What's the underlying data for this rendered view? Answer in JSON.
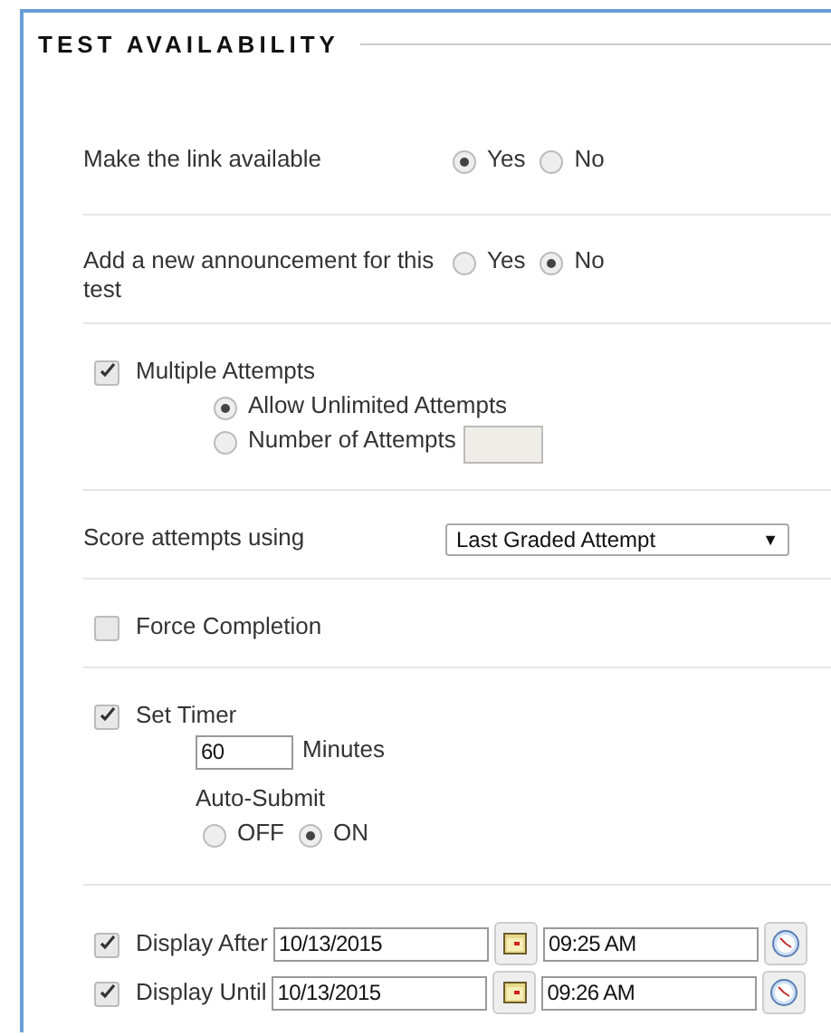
{
  "title": "TEST AVAILABILITY",
  "rows": [
    {
      "kind": "radio",
      "label": "Make the link available",
      "options": [
        {
          "label": "Yes",
          "selected": true
        },
        {
          "label": "No",
          "selected": false
        }
      ]
    },
    {
      "kind": "radio",
      "label": "Add a new announcement for this test",
      "options": [
        {
          "label": "Yes",
          "selected": false
        },
        {
          "label": "No",
          "selected": true
        }
      ]
    },
    {
      "kind": "attempts",
      "label": "Multiple Attempts",
      "checked": true,
      "options": [
        {
          "label": "Allow Unlimited Attempts",
          "selected": true
        },
        {
          "label": "Number of Attempts",
          "selected": false
        }
      ]
    },
    {
      "kind": "select",
      "label": "Score attempts using",
      "value": "Last Graded Attempt",
      "caret": "▼"
    },
    {
      "kind": "checkbox",
      "label": "Force Completion",
      "checked": false
    },
    {
      "kind": "timer",
      "label": "Set Timer",
      "checked": true,
      "value": "60",
      "unit": "Minutes",
      "sublabel": "Auto-Submit",
      "options": [
        {
          "label": "OFF",
          "selected": false
        },
        {
          "label": "ON",
          "selected": true
        }
      ]
    },
    {
      "kind": "dates",
      "items": [
        {
          "label": "Display After",
          "checked": true,
          "date": "10/13/2015",
          "time": "09:25 AM"
        },
        {
          "label": "Display Until",
          "checked": true,
          "date": "10/13/2015",
          "time": "09:26 AM"
        }
      ]
    }
  ]
}
